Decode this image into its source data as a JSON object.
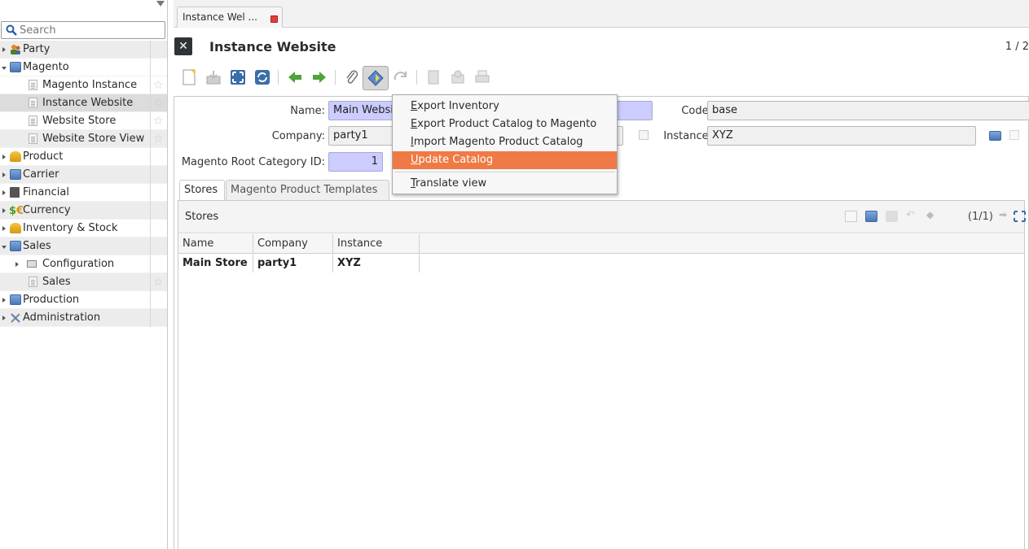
{
  "sidebar": {
    "search_placeholder": "Search",
    "items": [
      {
        "label": "Party"
      },
      {
        "label": "Magento"
      },
      {
        "label": "Magento Instance"
      },
      {
        "label": "Instance Website"
      },
      {
        "label": "Website Store"
      },
      {
        "label": "Website Store View"
      },
      {
        "label": "Product"
      },
      {
        "label": "Carrier"
      },
      {
        "label": "Financial"
      },
      {
        "label": "Currency"
      },
      {
        "label": "Inventory & Stock"
      },
      {
        "label": "Sales"
      },
      {
        "label": "Configuration"
      },
      {
        "label": "Sales"
      },
      {
        "label": "Production"
      },
      {
        "label": "Administration"
      }
    ]
  },
  "tab": {
    "label": "Instance Wel ..."
  },
  "header": {
    "title": "Instance Website",
    "page_count": "1 / 2"
  },
  "toolbar": {
    "icons": [
      "new-icon",
      "save-icon",
      "switch-view-icon",
      "reload-icon",
      "previous-icon",
      "next-icon",
      "attachment-icon",
      "action-icon",
      "relate-icon",
      "report-icon",
      "email-icon",
      "print-icon"
    ]
  },
  "form": {
    "name_label": "Name:",
    "name_value": "Main Websit",
    "code_label": "Code:",
    "code_value": "base",
    "company_label": "Company:",
    "company_value": "party1",
    "instance_label": "Instance:",
    "instance_value": "XYZ",
    "root_cat_label": "Magento Root Category ID:",
    "root_cat_value": "1",
    "tabs": [
      "Stores",
      "Magento Product Templates"
    ]
  },
  "stores": {
    "title": "Stores",
    "page_indicator": "(1/1)",
    "columns": [
      "Name",
      "Company",
      "Instance"
    ],
    "rows": [
      [
        "Main Store",
        "party1",
        "XYZ"
      ]
    ]
  },
  "menu": {
    "items": [
      {
        "u": "E",
        "rest": "xport Inventory"
      },
      {
        "u": "E",
        "rest": "xport Product Catalog to Magento"
      },
      {
        "u": "I",
        "rest": "mport Magento Product Catalog"
      },
      {
        "u": "U",
        "rest": "pdate Catalog"
      },
      {
        "u": "T",
        "rest": "ranslate view"
      }
    ]
  },
  "colors": {
    "accent": "#ef7a45",
    "required_field": "#ccccff",
    "folder": "#4a78b8"
  }
}
